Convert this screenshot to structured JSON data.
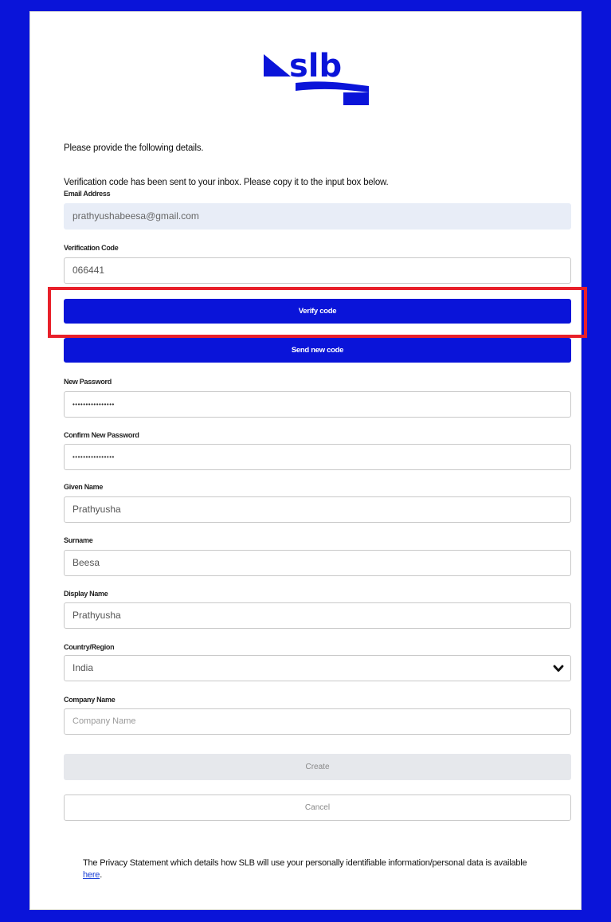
{
  "brand": {
    "logo_text": "slb",
    "accent_color": "#0a14d9"
  },
  "intro": {
    "instructions": "Please provide the following details.",
    "verification_notice": "Verification code has been sent to your inbox. Please copy it to the input box below."
  },
  "fields": {
    "email": {
      "label": "Email Address",
      "value": "prathyushabeesa@gmail.com"
    },
    "verification_code": {
      "label": "Verification Code",
      "value": "066441"
    },
    "new_password": {
      "label": "New Password",
      "value": "••••••••••••••••"
    },
    "confirm_password": {
      "label": "Confirm New Password",
      "value": "••••••••••••••••"
    },
    "given_name": {
      "label": "Given Name",
      "value": "Prathyusha"
    },
    "surname": {
      "label": "Surname",
      "value": "Beesa"
    },
    "display_name": {
      "label": "Display Name",
      "value": "Prathyusha"
    },
    "country": {
      "label": "Country/Region",
      "value": "India"
    },
    "company": {
      "label": "Company Name",
      "value": "",
      "placeholder": "Company Name"
    }
  },
  "buttons": {
    "verify": "Verify code",
    "send_new": "Send new code",
    "create": "Create",
    "cancel": "Cancel"
  },
  "privacy": {
    "text": "The Privacy Statement which details how SLB will use your personally identifiable information/personal data is available ",
    "link_text": "here",
    "suffix": "."
  }
}
